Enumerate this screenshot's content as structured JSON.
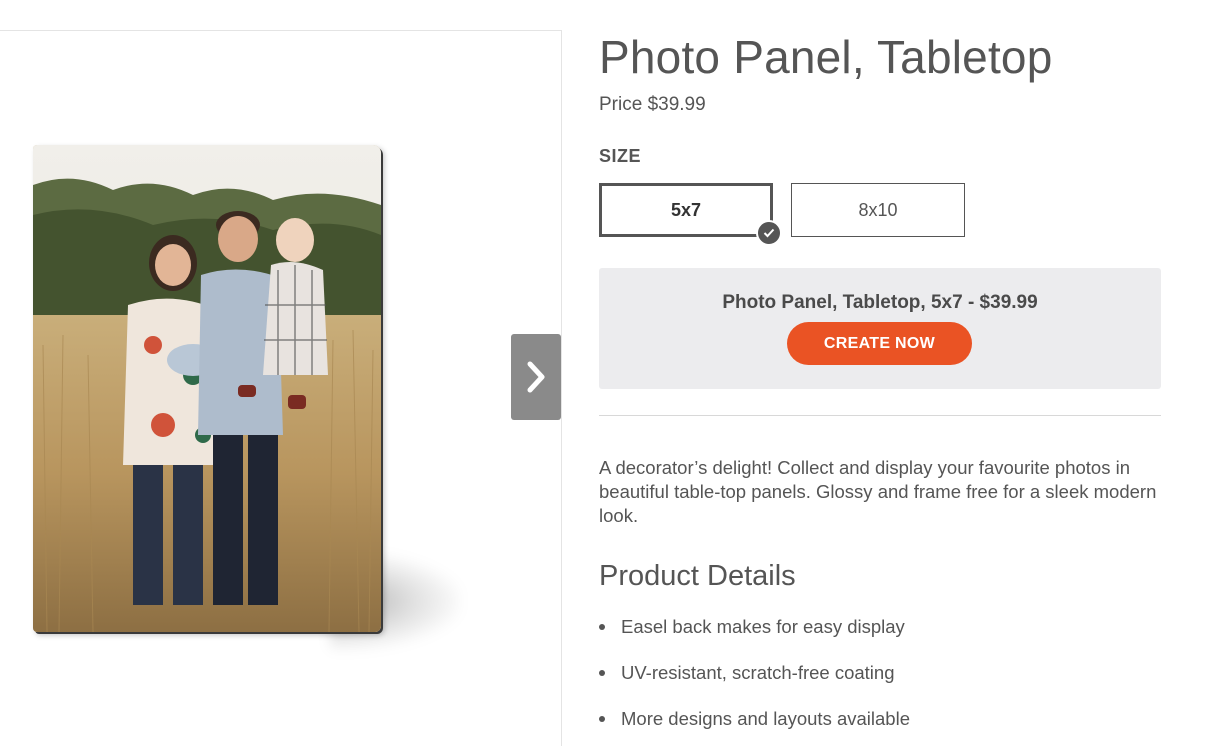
{
  "product": {
    "title": "Photo Panel, Tabletop",
    "price": "Price $39.99"
  },
  "size": {
    "label": "SIZE",
    "options": [
      {
        "label": "5x7",
        "selected": true
      },
      {
        "label": "8x10",
        "selected": false
      }
    ]
  },
  "summary": {
    "text": "Photo Panel, Tabletop, 5x7 - $39.99",
    "cta": "CREATE NOW"
  },
  "description": "A decorator’s delight! Collect and display your favourite photos in beautiful table-top panels. Glossy and frame free for a sleek modern look.",
  "details": {
    "heading": "Product Details",
    "items": [
      "Easel back makes for easy display",
      "UV-resistant, scratch-free coating",
      "More designs and layouts available"
    ]
  },
  "gallery": {
    "image": "family-photo-in-field",
    "next_icon": "chevron-right-icon"
  },
  "colors": {
    "accent": "#ea5324",
    "summary_bg": "#ececee",
    "text": "#555555"
  }
}
